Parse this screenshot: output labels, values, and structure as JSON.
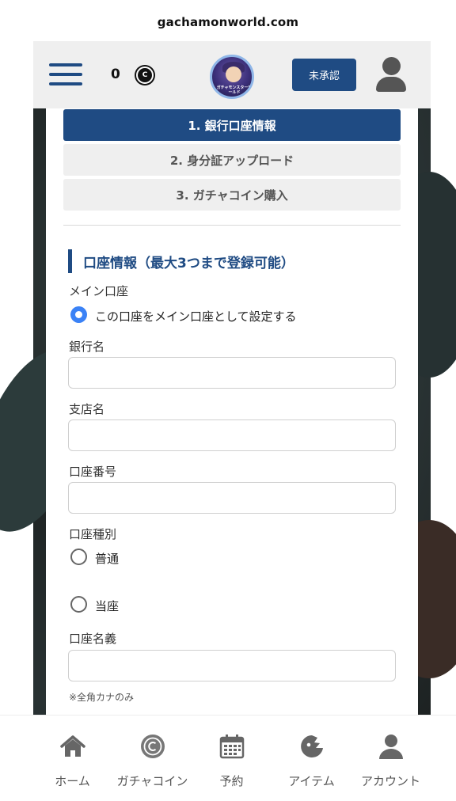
{
  "browser": {
    "url": "gachamonworld.com"
  },
  "header": {
    "coin_count": "0",
    "coin_symbol": "C",
    "logo_text": "ガチャモンスターワールド",
    "status_label": "未承認"
  },
  "steps": [
    {
      "label": "1. 銀行口座情報",
      "active": true
    },
    {
      "label": "2. 身分証アップロード",
      "active": false
    },
    {
      "label": "3. ガチャコイン購入",
      "active": false
    }
  ],
  "form": {
    "section_title": "口座情報（最大3つまで登録可能）",
    "main_account_label": "メイン口座",
    "main_account_option": "この口座をメイン口座として設定する",
    "bank_name_label": "銀行名",
    "bank_name_value": "",
    "branch_name_label": "支店名",
    "branch_name_value": "",
    "account_number_label": "口座番号",
    "account_number_value": "",
    "account_type_label": "口座種別",
    "account_type_options": [
      "普通",
      "当座"
    ],
    "account_holder_label": "口座名義",
    "account_holder_value": "",
    "account_holder_note": "※全角カナのみ"
  },
  "tabbar": {
    "items": [
      {
        "label": "ホーム",
        "icon": "home-icon"
      },
      {
        "label": "ガチャコイン",
        "icon": "coin-icon"
      },
      {
        "label": "予約",
        "icon": "calendar-icon"
      },
      {
        "label": "アイテム",
        "icon": "item-icon"
      },
      {
        "label": "アカウント",
        "icon": "account-icon"
      }
    ]
  },
  "colors": {
    "primary": "#1f4b83",
    "radio_checked": "#3b82f6",
    "header_bg": "#efefef"
  }
}
